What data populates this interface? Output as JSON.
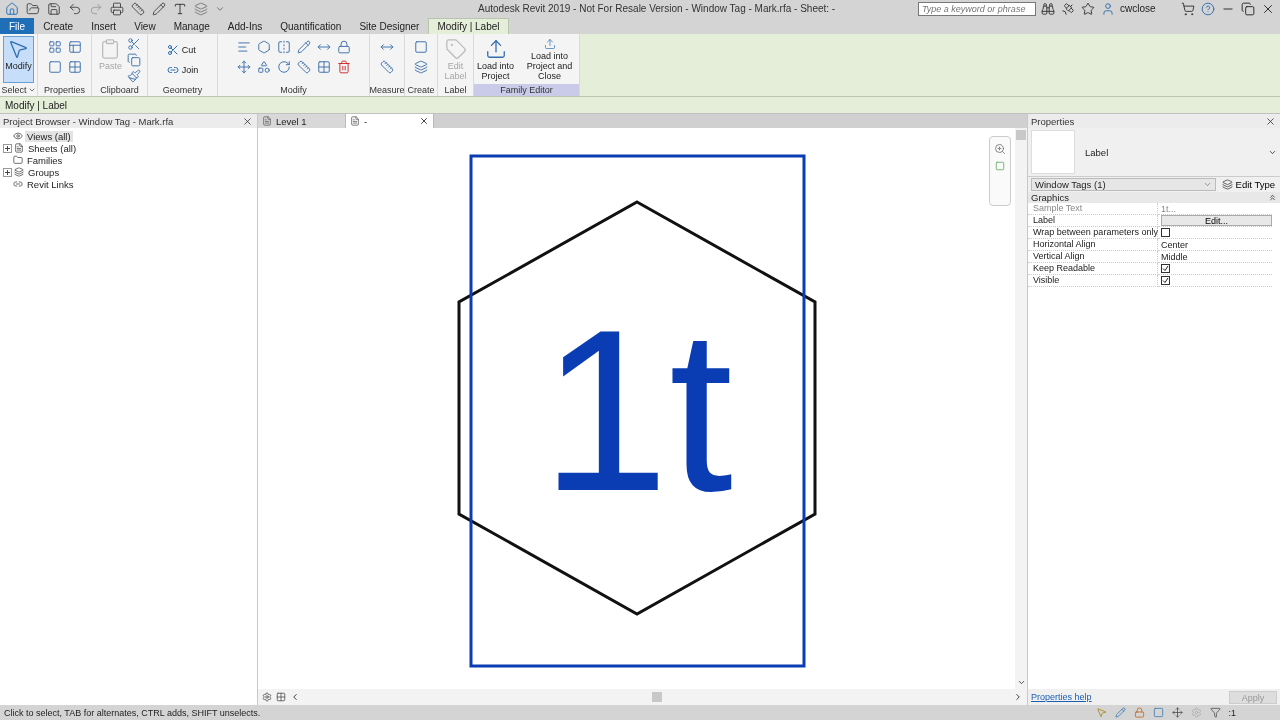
{
  "window": {
    "title": "Autodesk Revit 2019 - Not For Resale Version - Window Tag - Mark.rfa - Sheet: -",
    "search_placeholder": "Type a keyword or phrase",
    "user": "cwclose"
  },
  "ribbon_tabs": [
    {
      "label": "File",
      "kind": "file",
      "selected": false
    },
    {
      "label": "Create",
      "kind": "tab",
      "selected": false
    },
    {
      "label": "Insert",
      "kind": "tab",
      "selected": false
    },
    {
      "label": "View",
      "kind": "tab",
      "selected": false
    },
    {
      "label": "Manage",
      "kind": "tab",
      "selected": false
    },
    {
      "label": "Add-Ins",
      "kind": "tab",
      "selected": false
    },
    {
      "label": "Quantification",
      "kind": "tab",
      "selected": false
    },
    {
      "label": "Site Designer",
      "kind": "tab",
      "selected": false
    },
    {
      "label": "Modify | Label",
      "kind": "tab",
      "selected": true
    }
  ],
  "ribbon_panels": [
    {
      "label": "Select",
      "has_menu": true,
      "tools": [
        {
          "label": "Modify",
          "kind": "large",
          "disabled": false,
          "selected": true
        }
      ]
    },
    {
      "label": "Properties",
      "has_menu": false
    },
    {
      "label": "Clipboard",
      "has_menu": false,
      "tools": [
        {
          "label": "Paste",
          "kind": "large",
          "disabled": true,
          "selected": false
        }
      ]
    },
    {
      "label": "Geometry",
      "has_menu": false,
      "tools": [
        {
          "label": "Cut",
          "kind": "small",
          "disabled": false,
          "selected": false
        },
        {
          "label": "Join",
          "kind": "small",
          "disabled": false,
          "selected": false
        }
      ]
    },
    {
      "label": "Modify",
      "has_menu": false
    },
    {
      "label": "Measure",
      "has_menu": false
    },
    {
      "label": "Create",
      "has_menu": false
    },
    {
      "label": "Label",
      "has_menu": false,
      "tools": [
        {
          "label": "Edit Label",
          "kind": "large",
          "disabled": true,
          "selected": false
        }
      ]
    },
    {
      "label": "Family Editor",
      "has_menu": false,
      "tools": [
        {
          "label": "Load into Project",
          "kind": "large",
          "disabled": false,
          "selected": false
        },
        {
          "label": "Load into Project and Close",
          "kind": "large",
          "disabled": false,
          "selected": false
        }
      ]
    }
  ],
  "options_bar": "Modify | Label",
  "project_browser": {
    "title": "Project Browser - Window Tag - Mark.rfa",
    "items": [
      {
        "label": "Views (all)",
        "expandable": false,
        "selected": true
      },
      {
        "label": "Sheets (all)",
        "expandable": true,
        "selected": false
      },
      {
        "label": "Families",
        "expandable": false,
        "selected": false
      },
      {
        "label": "Groups",
        "expandable": true,
        "selected": false
      },
      {
        "label": "Revit Links",
        "expandable": false,
        "selected": false
      }
    ]
  },
  "view_tabs": [
    {
      "label": "Level 1",
      "selected": false
    },
    {
      "label": "-",
      "selected": true
    }
  ],
  "canvas": {
    "label_text": "1t"
  },
  "properties": {
    "title": "Properties",
    "type_name": "Label",
    "type_selector": "Window Tags (1)",
    "edit_type": "Edit Type",
    "group": "Graphics",
    "rows": [
      {
        "name": "Sample Text",
        "kind": "text",
        "value": "1t...",
        "disabled": true
      },
      {
        "name": "Label",
        "kind": "button",
        "value": "Edit...",
        "disabled": false
      },
      {
        "name": "Wrap between parameters only",
        "kind": "checkbox",
        "checked": false,
        "disabled": false
      },
      {
        "name": "Horizontal Align",
        "kind": "text",
        "value": "Center",
        "disabled": false
      },
      {
        "name": "Vertical Align",
        "kind": "text",
        "value": "Middle",
        "disabled": false
      },
      {
        "name": "Keep Readable",
        "kind": "checkbox",
        "checked": true,
        "disabled": false
      },
      {
        "name": "Visible",
        "kind": "checkbox",
        "checked": true,
        "disabled": false
      }
    ],
    "help_link": "Properties help",
    "apply": "Apply"
  },
  "status_bar": {
    "text": "Click to select, TAB for alternates, CTRL adds, SHIFT unselects.",
    "filter_count": ":1"
  }
}
